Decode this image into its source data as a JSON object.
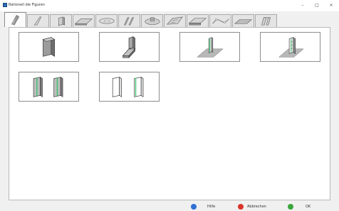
{
  "window": {
    "title": "Rationell die Figuren",
    "minimize_symbol": "–",
    "maximize_symbol": "□",
    "close_symbol": "×"
  },
  "tabs": [
    {
      "icon": "thin-wall-shape-icon"
    },
    {
      "icon": "tapered-wall-shape-icon"
    },
    {
      "icon": "column-shape-icon"
    },
    {
      "icon": "slab-shape-icon"
    },
    {
      "icon": "round-slab-shape-icon"
    },
    {
      "icon": "double-wall-shape-icon"
    },
    {
      "icon": "disc-shape-icon"
    },
    {
      "icon": "sloped-slab-shape-icon"
    },
    {
      "icon": "thick-slab-shape-icon"
    },
    {
      "icon": "curved-shape-icon"
    },
    {
      "icon": "flat-plate-shape-icon"
    },
    {
      "icon": "bracket-shape-icon"
    }
  ],
  "active_tab_index": 0,
  "figures": [
    {
      "icon": "solid-block-figure-icon"
    },
    {
      "icon": "l-shaped-figure-icon"
    },
    {
      "icon": "wall-on-plane-figure-icon"
    },
    {
      "icon": "pillar-on-plane-figure-icon"
    },
    {
      "icon": "twin-shaded-walls-figure-icon"
    },
    {
      "icon": "twin-outline-walls-figure-icon"
    }
  ],
  "footer": {
    "help_label": "Hilfe",
    "cancel_label": "Abbrechen",
    "ok_label": "OK",
    "help_color": "#2f6fd6",
    "cancel_color": "#d9342b",
    "ok_color": "#3aa53a"
  }
}
